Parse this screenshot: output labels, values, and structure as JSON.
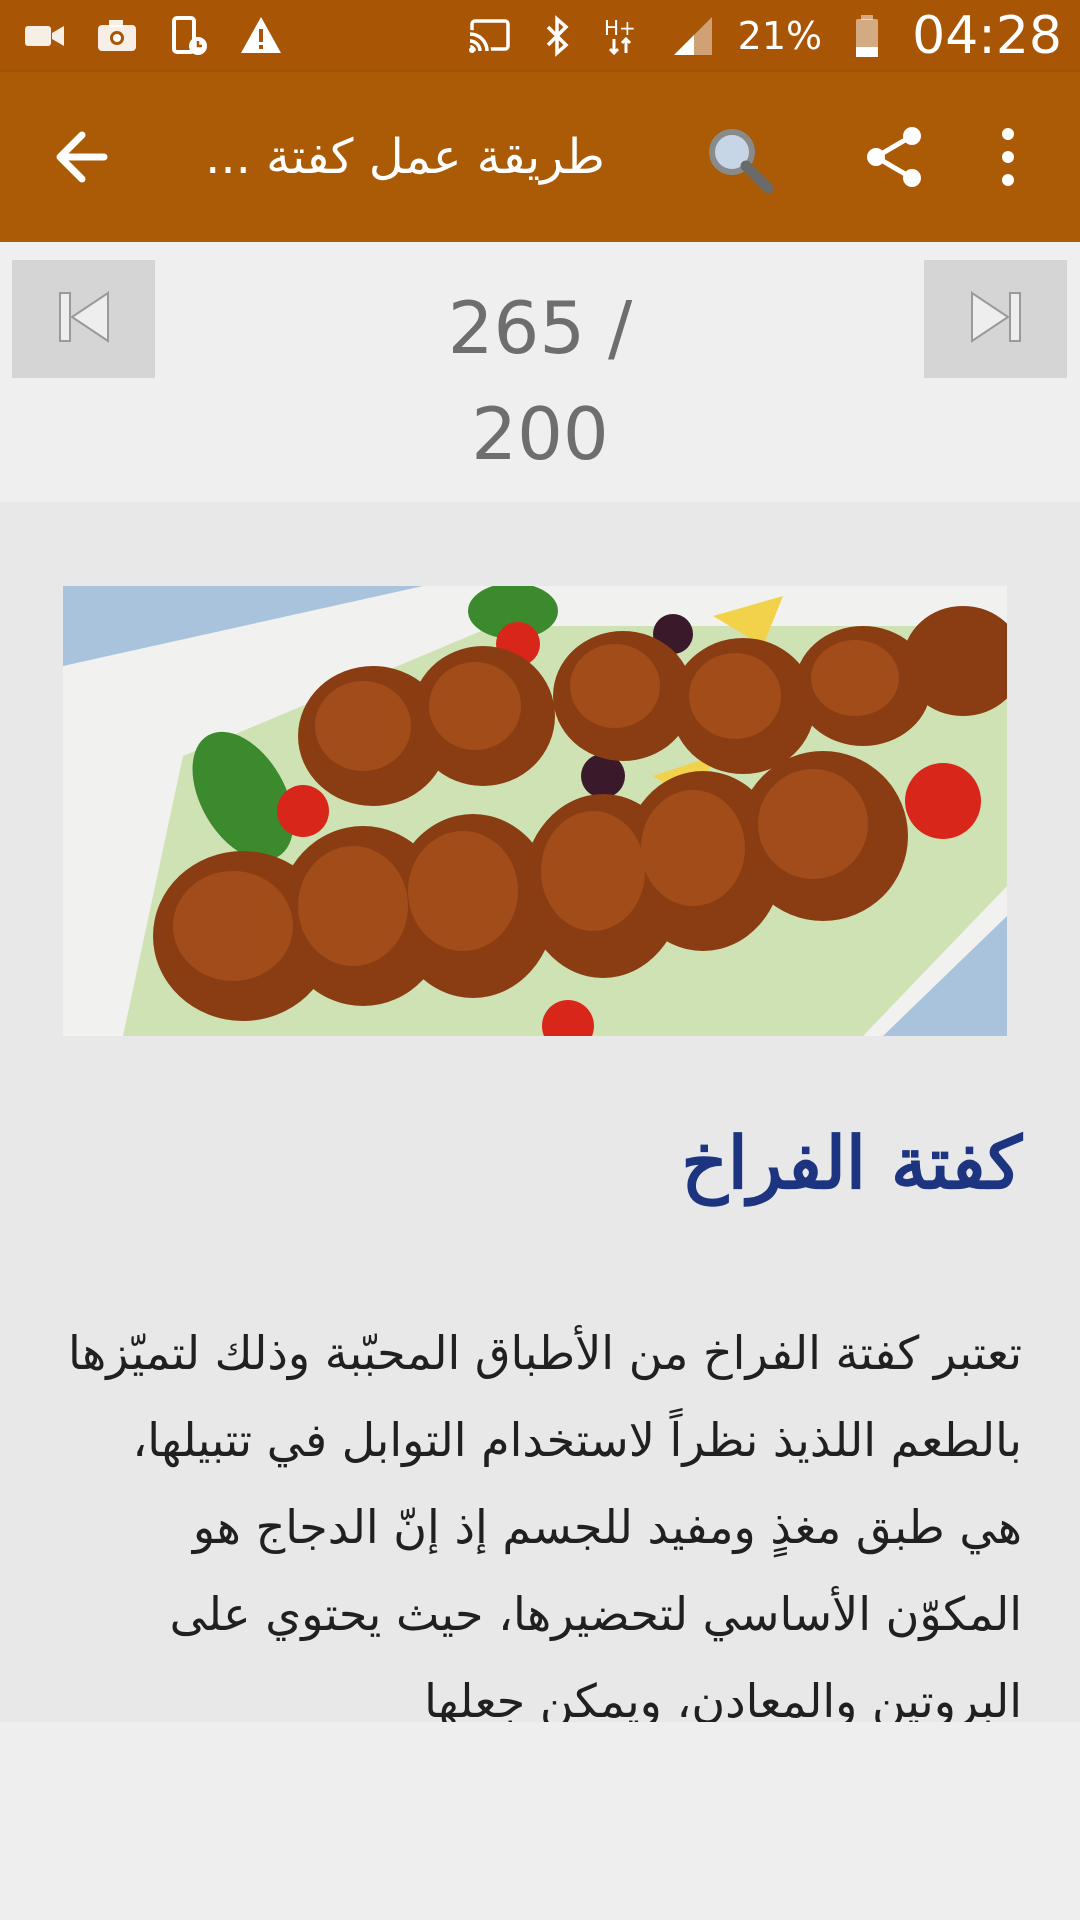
{
  "status_bar": {
    "battery": "21%",
    "time": "04:28",
    "network": "H+",
    "icons": [
      "video-icon",
      "camera-icon",
      "phone-clock-icon",
      "warning-icon",
      "cast-icon",
      "bluetooth-icon",
      "signal-icon",
      "battery-icon"
    ]
  },
  "app_bar": {
    "title": "طريقة عمل كفتة ...",
    "icons": [
      "back-arrow-icon",
      "search-icon",
      "share-icon",
      "more-vert-icon"
    ],
    "color": "#ab5a05"
  },
  "pager": {
    "total": "265 /",
    "current": "200",
    "icons": [
      "skip-previous-icon",
      "skip-next-icon"
    ]
  },
  "article": {
    "image_alt": "food-photo",
    "title": "كفتة الفراخ",
    "title_color": "#1d3580",
    "body": "تعتبر كفتة الفراخ من الأطباق المحبّبة وذلك لتميّزها بالطعم اللذيذ نظراً لاستخدام التوابل في تتبيلها، هي طبق مغذٍ ومفيد للجسم إذ إنّ الدجاج هو المكوّن الأساسي لتحضيرها، حيث يحتوي على البروتين والمعادن، ويمكن جعلها"
  }
}
